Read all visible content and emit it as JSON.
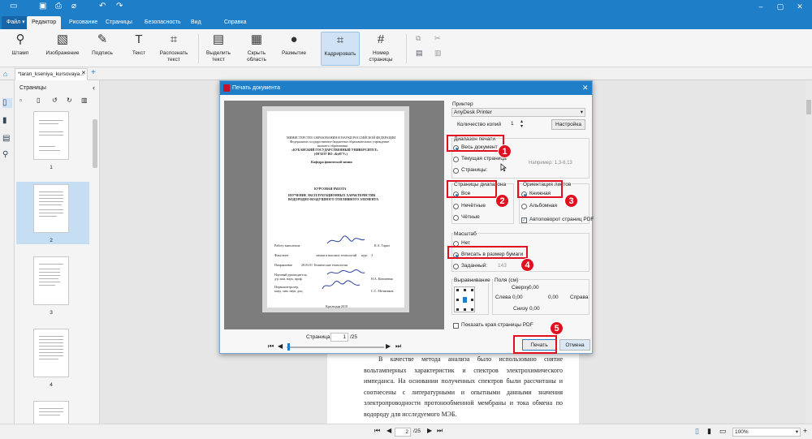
{
  "ribbon_tabs": {
    "file": "Файл",
    "editor": "Редактор",
    "drawing": "Рисование",
    "pages": "Страницы",
    "security": "Безопасность",
    "view": "Вид",
    "help": "Справка"
  },
  "ribbon": {
    "stamp": "Штамп",
    "image": "Изображение",
    "signature": "Подпись",
    "text": "Текст",
    "recognize": "Распознать текст",
    "select_text": "Выделить текст",
    "hide_area": "Скрыть область",
    "blur": "Размытие",
    "crop": "Кадрировать",
    "page_number": "Номер страницы"
  },
  "document_tab": "*taran_kseniya_kursovaya...",
  "pages_panel": {
    "title": "Страницы",
    "thumbs": [
      "1",
      "2",
      "3",
      "4"
    ]
  },
  "document_text": "В качестве метода анализа было использовано снятие вольтамперных характеристик и спектров электрохимического импеданса. На основании полученных спектров были рассчитаны и соотнесены с литературными и опытными данными значения электропроводности протонообменной мембраны и тока обмена по водороду для исследуемого МЭБ.",
  "status": {
    "page": "2",
    "total": "/25",
    "zoom": "100%"
  },
  "dialog": {
    "title": "Печать документа",
    "printer_label": "Принтер",
    "printer": "AnyDesk Printer",
    "copies_label": "Количество копий",
    "copies": "1",
    "setup": "Настройка",
    "range_label": "Диапазон печати",
    "all_doc": "Весь документ",
    "current_page": "Текущая страница",
    "pages_opt": "Страницы:",
    "pages_hint": "Например: 1,3-8,13",
    "subset_label": "Страницы диапазона",
    "all": "Все",
    "odd": "Нечётные",
    "even": "Чётные",
    "orient_label": "Ориентация листов",
    "portrait": "Книжная",
    "landscape": "Альбомная",
    "autorotate": "Автоповорот страниц PDF",
    "scale_label": "Масштаб",
    "no": "Нет",
    "fit": "Вписать в размер бумаги",
    "custom": "Заданный:",
    "custom_val": "143",
    "align_label": "Выравнивание",
    "margins_label": "Поля (см)",
    "top": "Сверху",
    "left": "Слева",
    "right": "Справа",
    "bottom": "Снизу",
    "m_top": "0,00",
    "m_left": "0,00",
    "m_right": "0,00",
    "m_bottom": "0,00",
    "show_edges": "Показать края страницы PDF",
    "print": "Печать",
    "cancel": "Отмена",
    "page_label": "Страница",
    "page_num": "1",
    "page_total": "/25"
  },
  "preview_doc": {
    "l1": "МИНИСТЕРСТВО ОБРАЗОВАНИЯ И НАУКИ РОССИЙСКОЙ ФЕДЕРАЦИИ",
    "l2": "Федеральное государственное бюджетное образовательное учреждение",
    "l3": "высшего образования",
    "l4": "«КУБАНСКИЙ ГОСУДАРСТВЕННЫЙ УНИВЕРСИТЕТ»",
    "l5": "(ФГБОУ ВО «КубГУ»)",
    "l6": "Кафедра физической химии",
    "l7": "КУРСОВАЯ РАБОТА",
    "l8": "ИЗУЧЕНИЕ ЭКСПЛУАТАЦИОННЫХ ХАРАКТЕРИСТИК",
    "l9": "ВОДОРОДНО-ВОЗДУШНОГО ТОПЛИВНОГО ЭЛЕМЕНТА",
    "r1": "Работу выполнила",
    "r1n": "К.А. Таран",
    "r2": "Факультет",
    "r2v": "химии и высоких технологий",
    "r2c": "курс",
    "r2cv": "3",
    "r3": "Направление",
    "r3v": "28.03.01 Технические технологии",
    "r4": "Научный руководитель,",
    "r4b": "д-р хим. наук, проф.",
    "r4n": "Н.А. Кононенко",
    "r5": "Нормоконтролер,",
    "r5b": "канд. хим. наук, доц.",
    "r5n": "С.С. Мельников",
    "city": "Краснодар 2018"
  },
  "badges": [
    "1",
    "2",
    "3",
    "4",
    "5"
  ],
  "colors": {
    "accent": "#1e7ec8",
    "highlight": "#e0101e"
  }
}
